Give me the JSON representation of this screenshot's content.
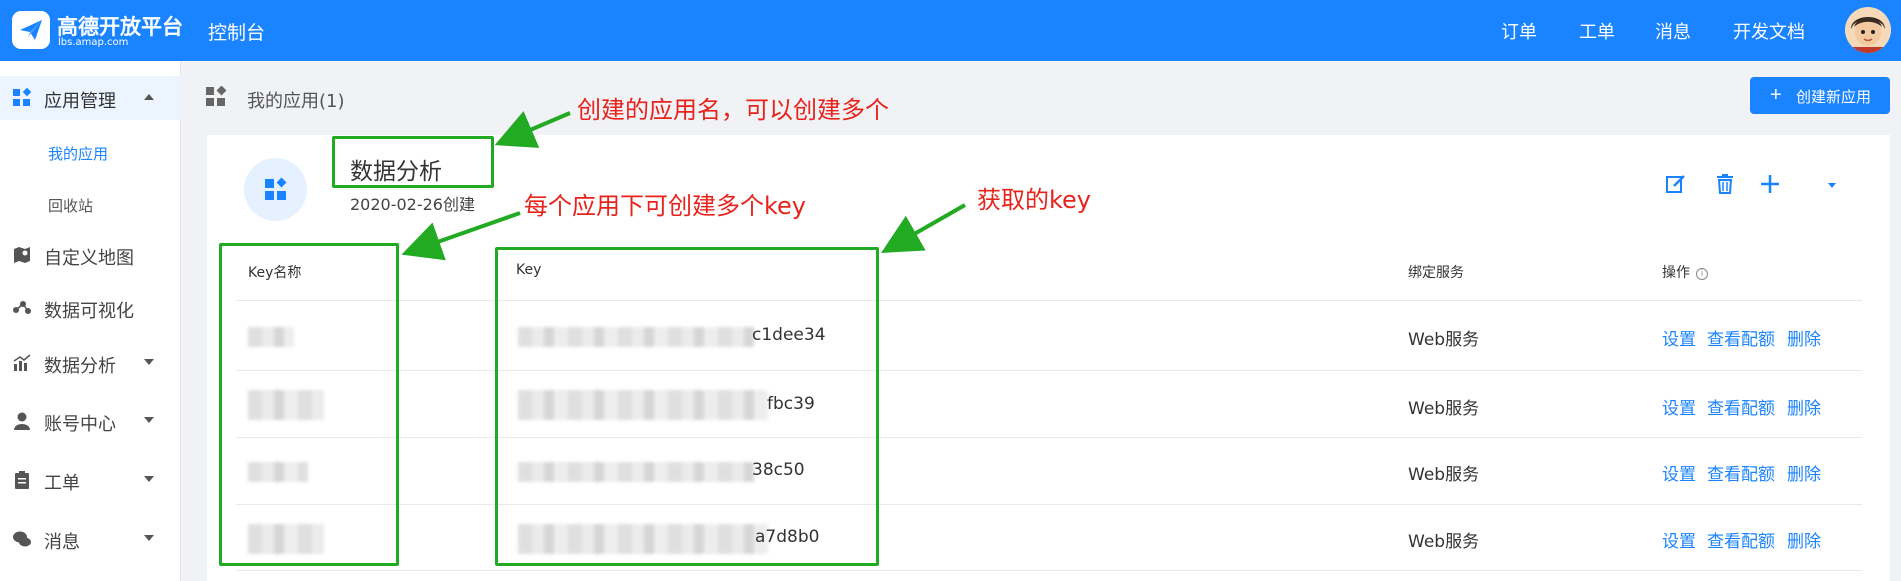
{
  "header": {
    "logo_title": "高德开放平台",
    "logo_sub": "lbs.amap.com",
    "console": "控制台",
    "nav": [
      "订单",
      "工单",
      "消息",
      "开发文档"
    ],
    "accent": "#1a83ff"
  },
  "sidebar": {
    "items": [
      {
        "label": "应用管理",
        "icon": "app-grid-icon",
        "expanded": true
      },
      {
        "label": "自定义地图",
        "icon": "custom-map-icon"
      },
      {
        "label": "数据可视化",
        "icon": "visualization-icon"
      },
      {
        "label": "数据分析",
        "icon": "bar-chart-icon",
        "expandable": true
      },
      {
        "label": "账号中心",
        "icon": "user-icon",
        "expandable": true
      },
      {
        "label": "工单",
        "icon": "clipboard-icon",
        "expandable": true
      },
      {
        "label": "消息",
        "icon": "chat-icon",
        "expandable": true
      }
    ],
    "subitems": [
      {
        "label": "我的应用",
        "active": true
      },
      {
        "label": "回收站"
      }
    ]
  },
  "page": {
    "title": "我的应用(1)",
    "create_button": "创建新应用"
  },
  "app": {
    "name": "数据分析",
    "created": "2020-02-26创建"
  },
  "table": {
    "columns": [
      "Key名称",
      "Key",
      "绑定服务",
      "操作"
    ],
    "rows": [
      {
        "key_suffix": "c1dee34",
        "service": "Web服务"
      },
      {
        "key_suffix": "fbc39",
        "service": "Web服务"
      },
      {
        "key_suffix": "38c50",
        "service": "Web服务"
      },
      {
        "key_suffix": "a7d8b0",
        "service": "Web服务"
      }
    ],
    "actions": [
      "设置",
      "查看配额",
      "删除"
    ]
  },
  "annotations": {
    "app_name_note": "创建的应用名，可以创建多个",
    "multi_key_note": "每个应用下可创建多个key",
    "key_note": "获取的key",
    "box_color": "#22aa22",
    "text_color": "#e8231c"
  }
}
